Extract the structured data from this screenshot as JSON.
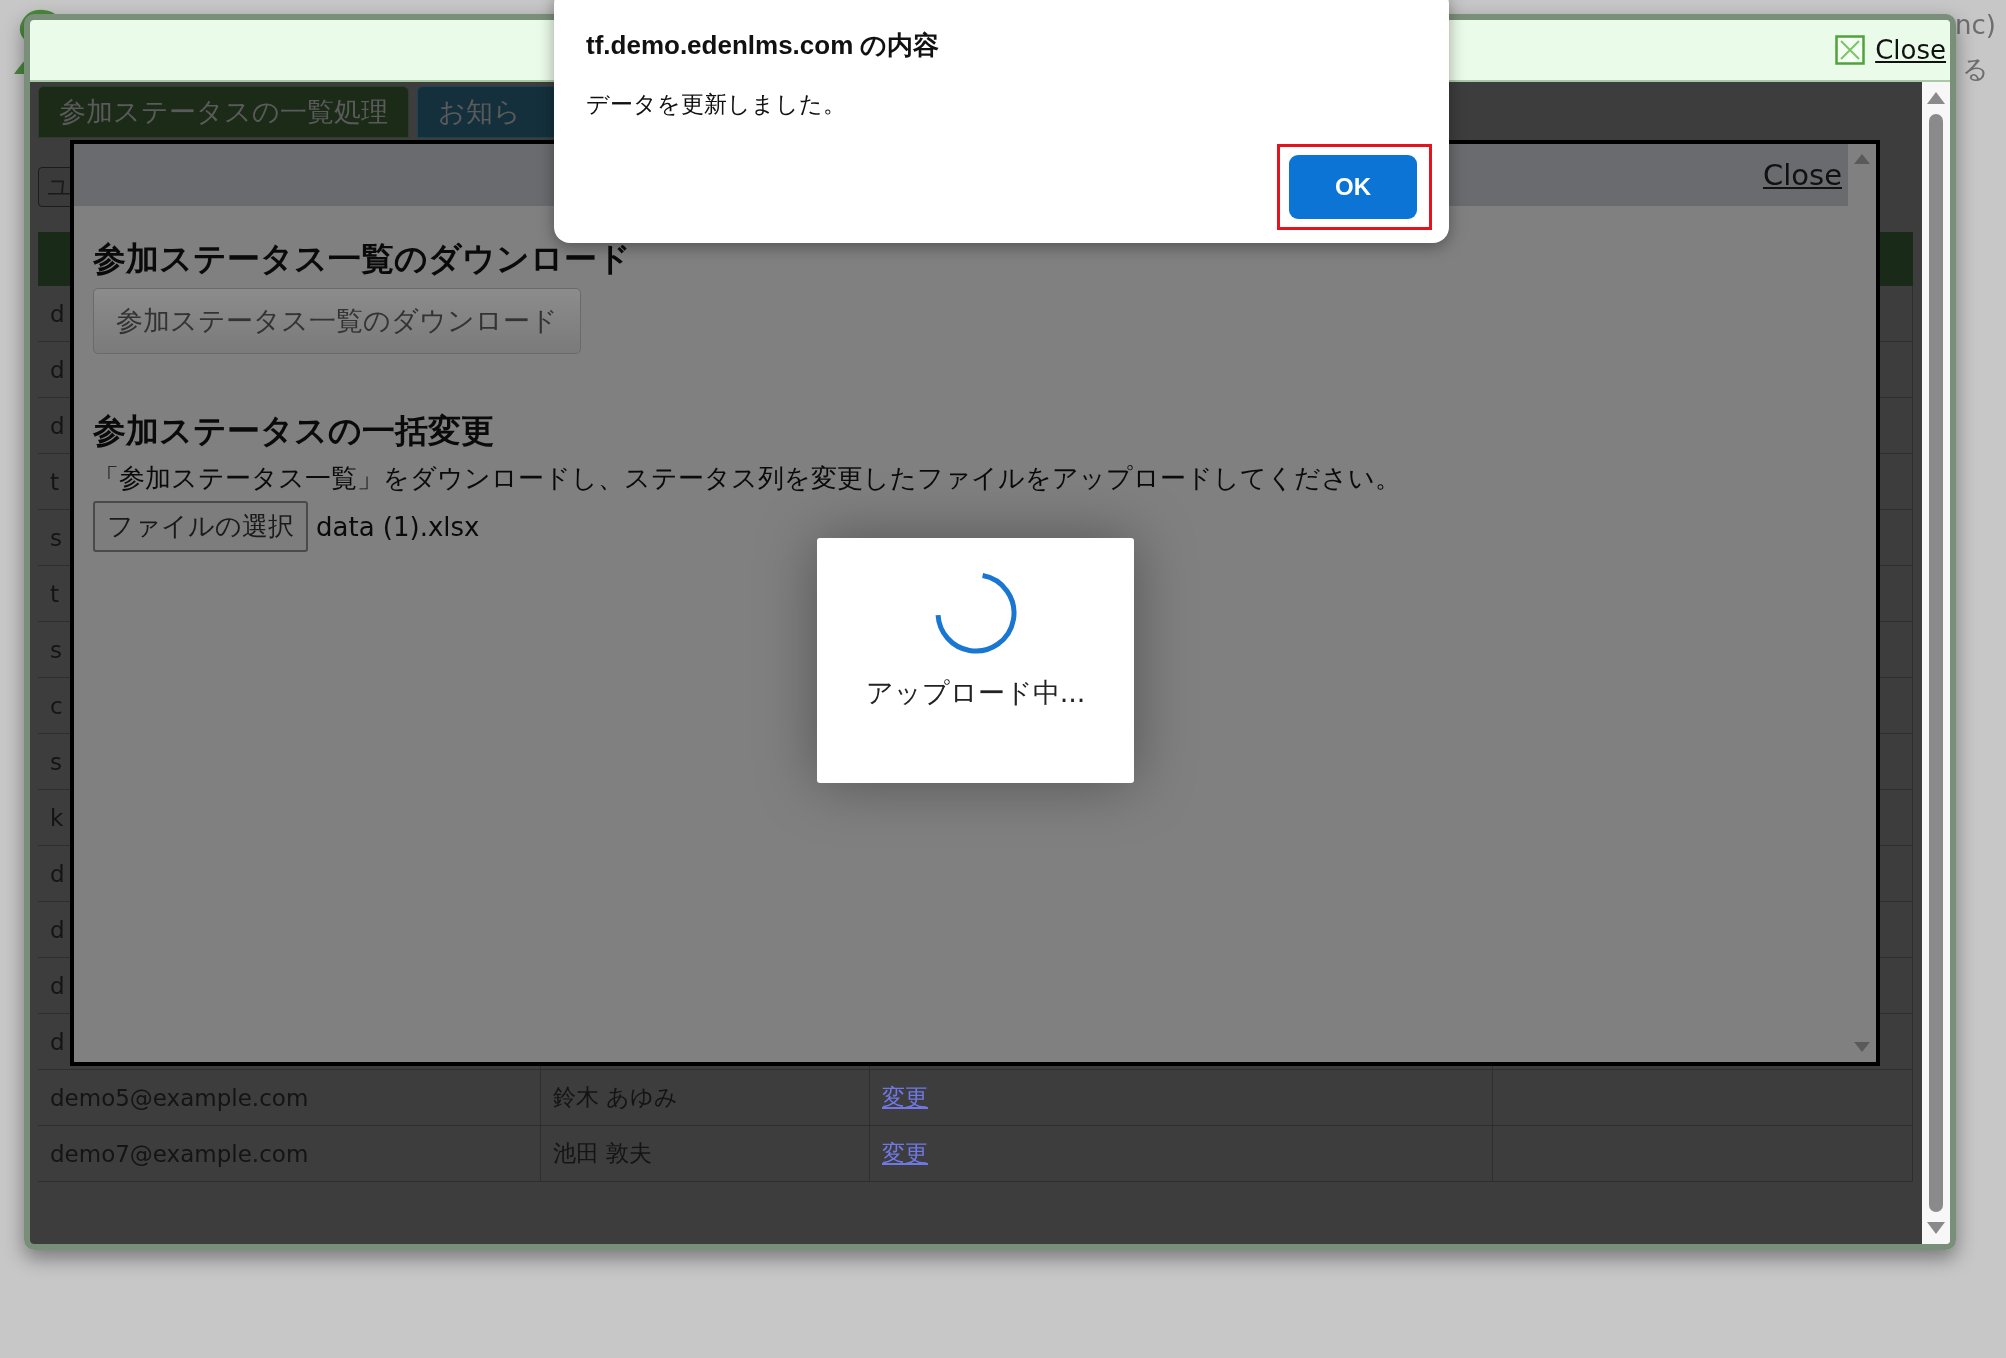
{
  "background_page": {
    "texts": [
      "nc)",
      "る"
    ]
  },
  "modal": {
    "close_label": "Close",
    "tabs": [
      {
        "label": "参加ステータスの一覧処理",
        "selected": true
      },
      {
        "label": "お知ら",
        "selected": false
      }
    ],
    "toolbar_button": "ユ",
    "table": {
      "rows": [
        {
          "email": "d"
        },
        {
          "email": "d"
        },
        {
          "email": "d"
        },
        {
          "email": "t"
        },
        {
          "email": "s"
        },
        {
          "email": "t"
        },
        {
          "email": "s"
        },
        {
          "email": "c"
        },
        {
          "email": "s"
        },
        {
          "email": "k"
        },
        {
          "email": "d"
        },
        {
          "email": "d"
        },
        {
          "email": "d"
        },
        {
          "email": "d"
        },
        {
          "email": "demo5@example.com",
          "name": "鈴木 あゆみ",
          "action": "変更"
        },
        {
          "email": "demo7@example.com",
          "name": "池田 敦夫",
          "action": "変更"
        }
      ]
    }
  },
  "dialog": {
    "close_label": "Close",
    "download_heading": "参加ステータス一覧のダウンロード",
    "download_button": "参加ステータス一覧のダウンロード",
    "bulk_heading": "参加ステータスの一括変更",
    "instructions": "「参加ステータス一覧」をダウンロードし、ステータス列を変更したファイルをアップロードしてください。",
    "file_button": "ファイルの選択",
    "file_name": "data (1).xlsx"
  },
  "loader": {
    "text": "アップロード中..."
  },
  "alert": {
    "title": "tf.demo.edenlms.com の内容",
    "message": "データを更新しました。",
    "ok_button": "OK",
    "ok_highlighted": true
  }
}
